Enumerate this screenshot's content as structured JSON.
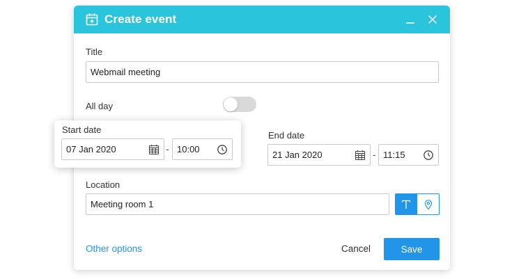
{
  "dialog": {
    "title": "Create event",
    "header_color": "#2ac4dc",
    "icons": {
      "title": "calendar-plus-icon",
      "minimize": "minimize-icon",
      "close": "close-icon"
    }
  },
  "form": {
    "title_label": "Title",
    "title_value": "Webmail meeting",
    "all_day_label": "All day",
    "all_day_on": false,
    "start_label": "Start date",
    "start_date": "07 Jan 2020",
    "start_time": "10:00",
    "end_label": "End date",
    "end_date": "21 Jan 2020",
    "end_time": "11:15",
    "separator": "-",
    "location_label": "Location",
    "location_value": "Meeting room 1"
  },
  "footer": {
    "other_options": "Other options",
    "cancel": "Cancel",
    "save": "Save"
  },
  "colors": {
    "accent": "#2196e8",
    "header": "#2ac4dc"
  }
}
